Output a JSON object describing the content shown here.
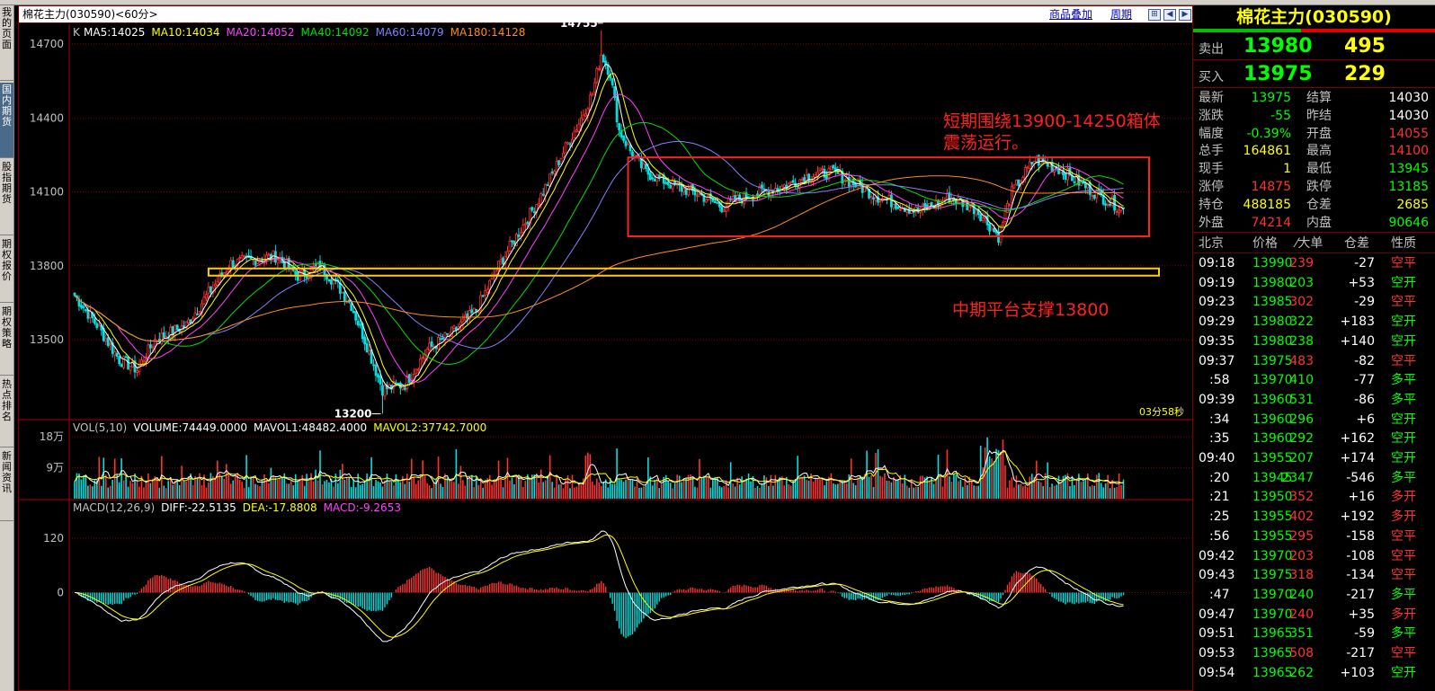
{
  "window": {
    "title": "棉花主力(030590)<60分>",
    "overlay_link": "商品叠加",
    "period_link": "周期"
  },
  "left_nav": [
    {
      "label": "我的页面",
      "active": false
    },
    {
      "label": "国内期货",
      "active": true
    },
    {
      "label": "股指期货",
      "active": false
    },
    {
      "label": "期权报价",
      "active": false
    },
    {
      "label": "期权策略",
      "active": false
    },
    {
      "label": "热点排名",
      "active": false
    },
    {
      "label": "新闻资讯",
      "active": false
    }
  ],
  "main_chart": {
    "label_k": "K",
    "ma_legend": [
      {
        "text": "MA5:14025",
        "color": "#ffffff"
      },
      {
        "text": "MA10:14034",
        "color": "#ffff00"
      },
      {
        "text": "MA20:14052",
        "color": "#ff40ff"
      },
      {
        "text": "MA40:14092",
        "color": "#00e000"
      },
      {
        "text": "MA60:14079",
        "color": "#8080ff"
      },
      {
        "text": "MA180:14128",
        "color": "#ff8c1a"
      }
    ],
    "y_ticks": [
      "14700",
      "14400",
      "14100",
      "13800",
      "13500"
    ],
    "y_values": [
      14700,
      14400,
      14100,
      13800,
      13500
    ],
    "high_label": "14755",
    "low_label": "13200",
    "countdown": "03分58秒",
    "annotation_box_text": [
      "短期围绕13900-14250箱体",
      "震荡运行。"
    ],
    "annotation_support_text": "中期平台支撑13800",
    "box_range": [
      13920,
      14240
    ],
    "support_level": 13775,
    "colors": {
      "up": "#ff3232",
      "down": "#00e0e0",
      "annot": "#ff2020",
      "support": "#ffd000"
    }
  },
  "volume_panel": {
    "legend": [
      {
        "text": "VOL(5,10)",
        "color": "#c0c0c0"
      },
      {
        "text": "VOLUME:74449.0000",
        "color": "#ffffff"
      },
      {
        "text": "MAVOL1:48482.4000",
        "color": "#ffffff"
      },
      {
        "text": "MAVOL2:37742.7000",
        "color": "#ffff00"
      }
    ],
    "y_ticks": [
      "18万",
      "9万"
    ],
    "y_values": [
      180000,
      90000
    ]
  },
  "macd_panel": {
    "legend": [
      {
        "text": "MACD(12,26,9)",
        "color": "#c0c0c0"
      },
      {
        "text": "DIFF:-22.5135",
        "color": "#ffffff"
      },
      {
        "text": "DEA:-17.8808",
        "color": "#ffff00"
      },
      {
        "text": "MACD:-9.2653",
        "color": "#ff40ff"
      }
    ],
    "y_ticks": [
      "120",
      "0"
    ],
    "y_values": [
      120,
      0
    ]
  },
  "quote": {
    "title": "棉花主力(030590)",
    "sell": {
      "label": "卖出",
      "price": "13980",
      "vol": "495"
    },
    "buy": {
      "label": "买入",
      "price": "13975",
      "vol": "229"
    },
    "stats": [
      {
        "l1": "最新",
        "v1": "13975",
        "c1": "#00ff00",
        "l2": "结算",
        "v2": "14030",
        "c2": "#ffffff"
      },
      {
        "l1": "涨跌",
        "v1": "-55",
        "c1": "#00ff00",
        "l2": "昨结",
        "v2": "14030",
        "c2": "#ffffff"
      },
      {
        "l1": "幅度",
        "v1": "-0.39%",
        "c1": "#00ff00",
        "l2": "开盘",
        "v2": "14055",
        "c2": "#ff3232"
      },
      {
        "l1": "总手",
        "v1": "164861",
        "c1": "#ffff00",
        "l2": "最高",
        "v2": "14100",
        "c2": "#ff3232"
      },
      {
        "l1": "现手",
        "v1": "1",
        "c1": "#ffff00",
        "l2": "最低",
        "v2": "13945",
        "c2": "#00ff00"
      },
      {
        "l1": "涨停",
        "v1": "14875",
        "c1": "#ff3232",
        "l2": "跌停",
        "v2": "13185",
        "c2": "#00ff00"
      },
      {
        "l1": "持仓",
        "v1": "488185",
        "c1": "#ffff00",
        "l2": "仓差",
        "v2": "2685",
        "c2": "#ffff00"
      },
      {
        "l1": "外盘",
        "v1": "74214",
        "c1": "#ff3232",
        "l2": "内盘",
        "v2": "90646",
        "c2": "#00ff00"
      }
    ],
    "tick_headers": [
      "北京",
      "价格",
      "⁄大单",
      "仓差",
      "性质"
    ],
    "ticks": [
      {
        "time": "09:18",
        "price": "13990",
        "vol": "239",
        "diff": "-27",
        "nature": "空平",
        "pc": "#00ff00",
        "vc": "#ff3232",
        "nc": "#ff3232"
      },
      {
        "time": "09:19",
        "price": "13980",
        "vol": "203",
        "diff": "+53",
        "nature": "空开",
        "pc": "#00ff00",
        "vc": "#00ff00",
        "nc": "#00ff00"
      },
      {
        "time": "09:23",
        "price": "13985",
        "vol": "302",
        "diff": "-29",
        "nature": "空平",
        "pc": "#00ff00",
        "vc": "#ff3232",
        "nc": "#ff3232"
      },
      {
        "time": "09:29",
        "price": "13980",
        "vol": "322",
        "diff": "+183",
        "nature": "空开",
        "pc": "#00ff00",
        "vc": "#00ff00",
        "nc": "#00ff00"
      },
      {
        "time": "09:35",
        "price": "13980",
        "vol": "238",
        "diff": "+140",
        "nature": "空开",
        "pc": "#00ff00",
        "vc": "#00ff00",
        "nc": "#00ff00"
      },
      {
        "time": "09:37",
        "price": "13975",
        "vol": "483",
        "diff": "-82",
        "nature": "空平",
        "pc": "#00ff00",
        "vc": "#ff3232",
        "nc": "#ff3232"
      },
      {
        "time": ":58",
        "price": "13970",
        "vol": "410",
        "diff": "-77",
        "nature": "多平",
        "pc": "#00ff00",
        "vc": "#00ff00",
        "nc": "#00ff00"
      },
      {
        "time": "09:39",
        "price": "13960",
        "vol": "531",
        "diff": "-86",
        "nature": "多平",
        "pc": "#00ff00",
        "vc": "#00ff00",
        "nc": "#00ff00"
      },
      {
        "time": ":34",
        "price": "13960",
        "vol": "296",
        "diff": "+6",
        "nature": "空开",
        "pc": "#00ff00",
        "vc": "#00ff00",
        "nc": "#00ff00"
      },
      {
        "time": ":35",
        "price": "13960",
        "vol": "292",
        "diff": "+162",
        "nature": "空开",
        "pc": "#00ff00",
        "vc": "#00ff00",
        "nc": "#00ff00"
      },
      {
        "time": "09:40",
        "price": "13955",
        "vol": "207",
        "diff": "+174",
        "nature": "空开",
        "pc": "#00ff00",
        "vc": "#00ff00",
        "nc": "#00ff00"
      },
      {
        "time": ":20",
        "price": "13945",
        "vol": "2347",
        "diff": "-546",
        "nature": "多平",
        "pc": "#00ff00",
        "vc": "#00ff00",
        "nc": "#00ff00"
      },
      {
        "time": ":21",
        "price": "13950",
        "vol": "352",
        "diff": "+16",
        "nature": "多开",
        "pc": "#00ff00",
        "vc": "#ff3232",
        "nc": "#ff3232"
      },
      {
        "time": ":25",
        "price": "13955",
        "vol": "402",
        "diff": "+192",
        "nature": "多开",
        "pc": "#00ff00",
        "vc": "#ff3232",
        "nc": "#ff3232"
      },
      {
        "time": ":56",
        "price": "13955",
        "vol": "295",
        "diff": "-158",
        "nature": "空平",
        "pc": "#00ff00",
        "vc": "#ff3232",
        "nc": "#ff3232"
      },
      {
        "time": "09:42",
        "price": "13970",
        "vol": "203",
        "diff": "-108",
        "nature": "空平",
        "pc": "#00ff00",
        "vc": "#ff3232",
        "nc": "#ff3232"
      },
      {
        "time": "09:43",
        "price": "13975",
        "vol": "318",
        "diff": "-134",
        "nature": "空平",
        "pc": "#00ff00",
        "vc": "#ff3232",
        "nc": "#ff3232"
      },
      {
        "time": ":47",
        "price": "13970",
        "vol": "240",
        "diff": "-217",
        "nature": "多平",
        "pc": "#00ff00",
        "vc": "#00ff00",
        "nc": "#00ff00"
      },
      {
        "time": "09:47",
        "price": "13970",
        "vol": "240",
        "diff": "+35",
        "nature": "多开",
        "pc": "#00ff00",
        "vc": "#ff3232",
        "nc": "#ff3232"
      },
      {
        "time": "09:51",
        "price": "13965",
        "vol": "351",
        "diff": "-59",
        "nature": "多平",
        "pc": "#00ff00",
        "vc": "#00ff00",
        "nc": "#00ff00"
      },
      {
        "time": "09:53",
        "price": "13965",
        "vol": "508",
        "diff": "-217",
        "nature": "空平",
        "pc": "#00ff00",
        "vc": "#ff3232",
        "nc": "#ff3232"
      },
      {
        "time": "09:54",
        "price": "13965",
        "vol": "262",
        "diff": "+103",
        "nature": "空开",
        "pc": "#00ff00",
        "vc": "#00ff00",
        "nc": "#00ff00"
      }
    ]
  },
  "chart_data": [
    {
      "type": "candlestick",
      "title": "棉花主力(030590)<60分>",
      "y_ticks": [
        14700,
        14400,
        14100,
        13800,
        13500
      ],
      "ylim": [
        13180,
        14780
      ],
      "high": 14755,
      "low": 13200,
      "anchors": [
        [
          0,
          13680
        ],
        [
          10,
          13560
        ],
        [
          20,
          13420
        ],
        [
          28,
          13380
        ],
        [
          36,
          13500
        ],
        [
          50,
          13560
        ],
        [
          60,
          13690
        ],
        [
          70,
          13810
        ],
        [
          90,
          13840
        ],
        [
          100,
          13760
        ],
        [
          110,
          13800
        ],
        [
          118,
          13720
        ],
        [
          124,
          13640
        ],
        [
          130,
          13500
        ],
        [
          138,
          13300
        ],
        [
          148,
          13320
        ],
        [
          158,
          13460
        ],
        [
          168,
          13520
        ],
        [
          180,
          13620
        ],
        [
          190,
          13800
        ],
        [
          200,
          13950
        ],
        [
          210,
          14100
        ],
        [
          220,
          14280
        ],
        [
          226,
          14380
        ],
        [
          232,
          14500
        ],
        [
          236,
          14660
        ],
        [
          240,
          14580
        ],
        [
          244,
          14350
        ],
        [
          250,
          14250
        ],
        [
          256,
          14180
        ],
        [
          270,
          14120
        ],
        [
          280,
          14090
        ],
        [
          290,
          14040
        ],
        [
          300,
          14080
        ],
        [
          320,
          14130
        ],
        [
          330,
          14170
        ],
        [
          340,
          14180
        ],
        [
          360,
          14080
        ],
        [
          378,
          14020
        ],
        [
          392,
          14080
        ],
        [
          404,
          14030
        ],
        [
          414,
          13920
        ],
        [
          420,
          14100
        ],
        [
          430,
          14230
        ],
        [
          440,
          14200
        ],
        [
          450,
          14140
        ],
        [
          460,
          14080
        ],
        [
          470,
          14030
        ]
      ],
      "series": [
        {
          "name": "MA5",
          "value": 14025
        },
        {
          "name": "MA10",
          "value": 14034
        },
        {
          "name": "MA20",
          "value": 14052
        },
        {
          "name": "MA40",
          "value": 14092
        },
        {
          "name": "MA60",
          "value": 14079
        },
        {
          "name": "MA180",
          "value": 14128
        }
      ]
    },
    {
      "type": "bar",
      "title": "VOL(5,10)",
      "y_ticks": [
        180000,
        90000
      ],
      "ylim": [
        0,
        230000
      ],
      "series": [
        {
          "name": "VOLUME",
          "value": 74449
        },
        {
          "name": "MAVOL1",
          "value": 48482.4
        },
        {
          "name": "MAVOL2",
          "value": 37742.7
        }
      ]
    },
    {
      "type": "bar",
      "title": "MACD(12,26,9)",
      "y_ticks": [
        120,
        0
      ],
      "ylim": [
        -215,
        205
      ],
      "series": [
        {
          "name": "DIFF",
          "value": -22.5135
        },
        {
          "name": "DEA",
          "value": -17.8808
        },
        {
          "name": "MACD",
          "value": -9.2653
        }
      ]
    }
  ]
}
